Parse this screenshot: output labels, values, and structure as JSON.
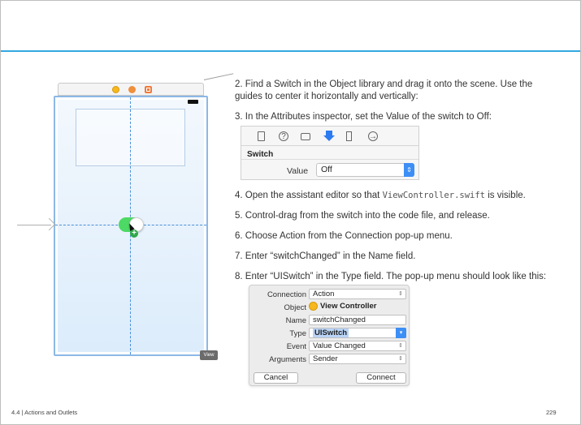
{
  "steps": [
    {
      "text": "2. Find a Switch in the Object library and drag it onto the scene. Use the guides to center it horizontally and vertically:"
    },
    {
      "text": "3. In the Attributes inspector, set the Value of the switch to Off:"
    },
    {
      "before": "4. Open the assistant editor so that ",
      "code": "ViewController.swift",
      "after": " is visible."
    },
    {
      "text": "5. Control-drag from the switch into the code file, and release."
    },
    {
      "text": "6. Choose Action from the Connection pop-up menu."
    },
    {
      "text": "7. Enter “switchChanged” in the Name field."
    },
    {
      "text": "8. Enter “UISwitch” in the Type field. The pop-up menu should look like this:"
    }
  ],
  "inspector": {
    "section": "Switch",
    "value_label": "Value",
    "value": "Off",
    "tab_icons": [
      "file-icon",
      "help-icon",
      "identity-icon",
      "attributes-icon",
      "size-icon",
      "connections-icon"
    ]
  },
  "popup": {
    "connection_label": "Connection",
    "connection_value": "Action",
    "object_label": "Object",
    "object_value": "View Controller",
    "name_label": "Name",
    "name_value": "switchChanged",
    "type_label": "Type",
    "type_value": "UISwitch",
    "event_label": "Event",
    "event_value": "Value Changed",
    "arguments_label": "Arguments",
    "arguments_value": "Sender",
    "cancel": "Cancel",
    "connect": "Connect"
  },
  "storyboard": {
    "view_label": "View"
  },
  "footer": {
    "section": "4.4 | Actions and Outlets",
    "page": "229"
  },
  "colors": {
    "accent": "#33a9e0",
    "switch_on": "#4cd964",
    "selection": "#3d8ff5"
  }
}
